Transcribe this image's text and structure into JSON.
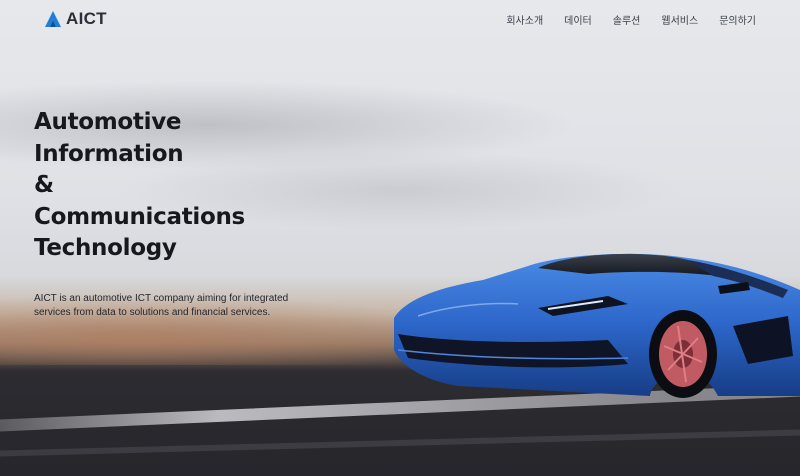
{
  "brand": {
    "name": "AICT"
  },
  "nav": {
    "items": [
      {
        "label": "회사소개"
      },
      {
        "label": "데이터"
      },
      {
        "label": "솔루션"
      },
      {
        "label": "웹서비스"
      },
      {
        "label": "문의하기"
      }
    ]
  },
  "hero": {
    "headline_lines": [
      "Automotive",
      "Information",
      "&",
      "Communications",
      "Technology"
    ],
    "description_lines": [
      "AICT is an automotive ICT company aiming for integrated",
      "services from data to solutions and financial services."
    ]
  },
  "colors": {
    "car_blue": "#2f6fd6",
    "text_dark": "#16181d",
    "logo_blue": "#1f7fd8"
  }
}
